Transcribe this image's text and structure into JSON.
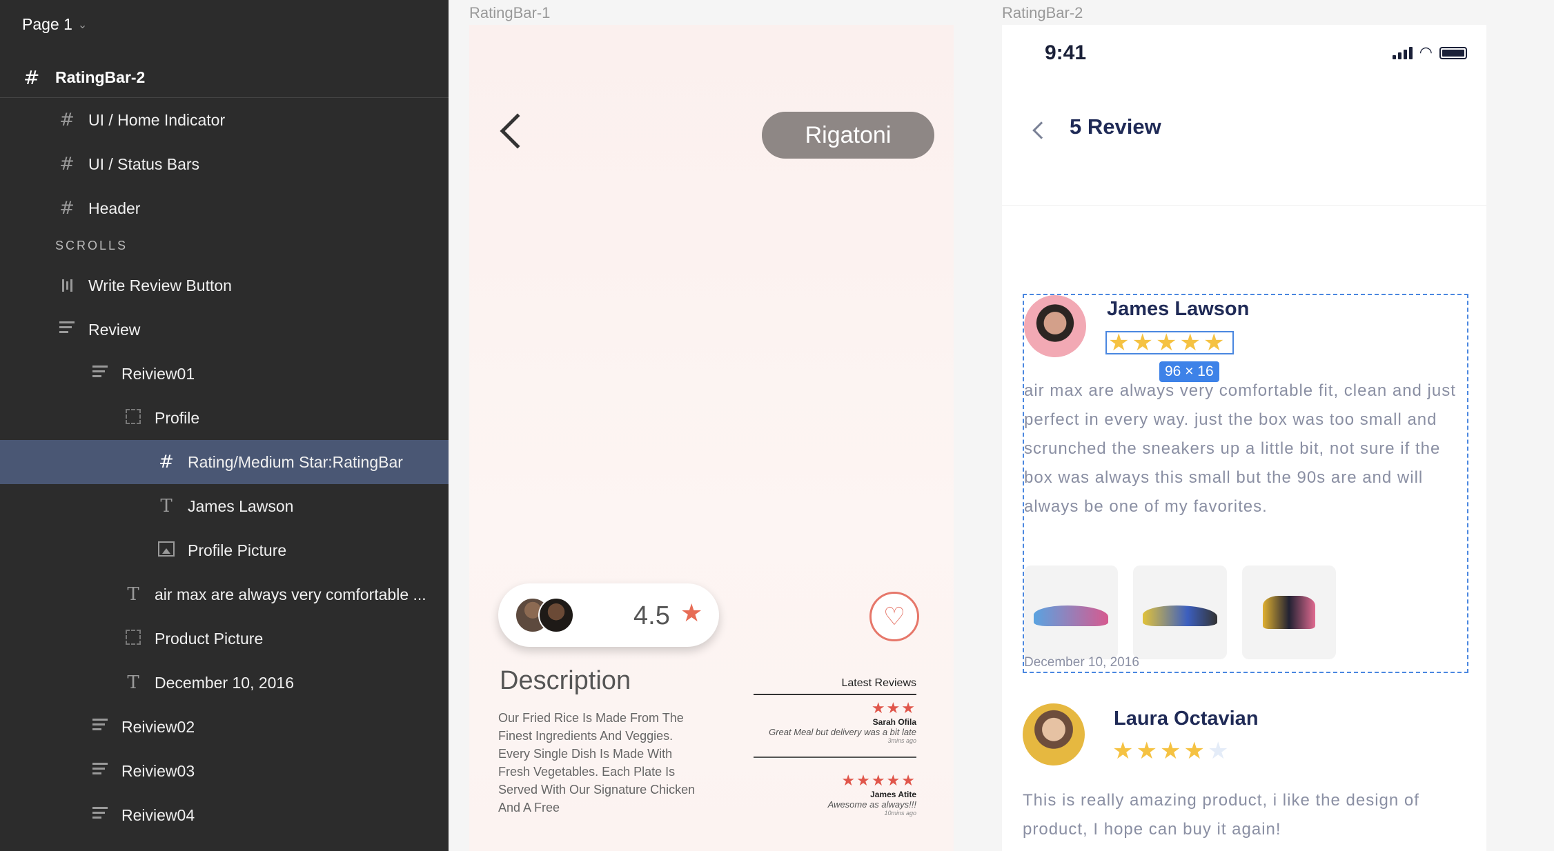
{
  "layers": {
    "page": "Page 1",
    "root": "RatingBar-2",
    "section_scrolls": "SCROLLS",
    "items": [
      {
        "label": "UI / Home Indicator"
      },
      {
        "label": "UI / Status Bars"
      },
      {
        "label": "Header"
      },
      {
        "label": "Write Review Button"
      },
      {
        "label": "Review"
      },
      {
        "label": "Reiview01"
      },
      {
        "label": "Profile"
      },
      {
        "label": "Rating/Medium Star:RatingBar"
      },
      {
        "label": "James Lawson"
      },
      {
        "label": "Profile Picture"
      },
      {
        "label": "air max are always very comfortable ..."
      },
      {
        "label": "Product Picture"
      },
      {
        "label": "December 10, 2016"
      },
      {
        "label": "Reiview02"
      },
      {
        "label": "Reiview03"
      },
      {
        "label": "Reiview04"
      }
    ]
  },
  "frame1": {
    "title": "RatingBar-1",
    "dish": "Rigatoni",
    "rating": "4.5",
    "description_title": "Description",
    "description": "Our Fried Rice Is Made From The Finest Ingredients And Veggies. Every Single Dish Is Made With Fresh Vegetables. Each Plate Is Served With Our Signature Chicken And A Free",
    "latest_reviews_label": "Latest Reviews",
    "reviews": [
      {
        "stars": "★★★",
        "name": "Sarah Ofila",
        "text": "Great Meal but delivery was a bit late",
        "time": "3mins ago"
      },
      {
        "stars": "★★★★★",
        "name": "James Atite",
        "text": "Awesome as always!!!",
        "time": "10mins ago"
      }
    ]
  },
  "frame2": {
    "title": "RatingBar-2",
    "status_time": "9:41",
    "header_title": "5 Review",
    "selection_size": "96 × 16",
    "review1": {
      "name": "James Lawson",
      "rating": 5,
      "body": "air max are always very comfortable fit, clean and just perfect in every way. just the box was too small and scrunched the sneakers up a little bit, not sure if the box was always this small but the 90s are and will always be one of my favorites.",
      "date": "December 10, 2016"
    },
    "review2": {
      "name": "Laura Octavian",
      "rating": 4,
      "body": "This is really amazing product, i like the design of product, I hope can buy it again!"
    }
  },
  "colors": {
    "accent_star": "#f5c242",
    "selection": "#4a87e0",
    "heart": "#e6776a"
  }
}
